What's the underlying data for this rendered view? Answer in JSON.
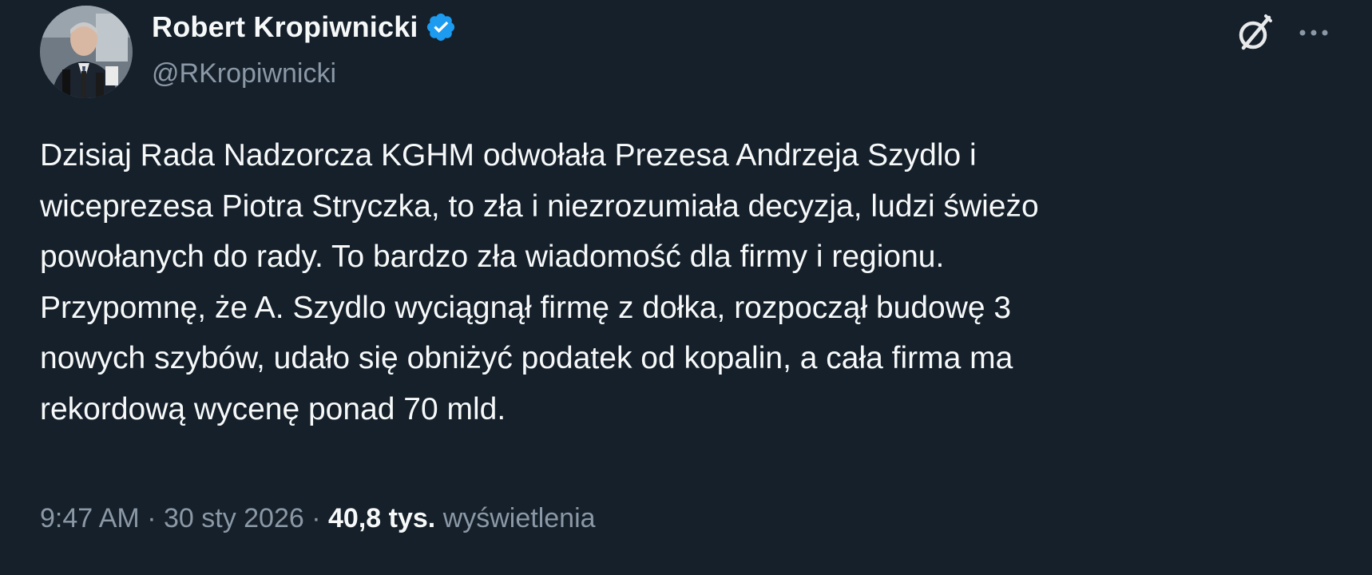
{
  "author": {
    "display_name": "Robert Kropiwnicki",
    "handle": "@RKropiwnicki",
    "verified": true
  },
  "icons": {
    "avatar": "profile-photo",
    "verified": "verified-badge-icon",
    "grok": "grok-icon",
    "more": "more-dots-icon"
  },
  "colors": {
    "background": "#15202b",
    "text_primary": "#f7f9f9",
    "text_secondary": "#8b98a5",
    "verified_blue": "#1d9bf0"
  },
  "tweet": {
    "text": "Dzisiaj Rada Nadzorcza KGHM odwołała Prezesa Andrzeja Szydlo i\nwiceprezesa Piotra Stryczka, to zła i niezrozumiała decyzja, ludzi świeżo\npowołanych do rady. To bardzo zła wiadomość dla firmy i regionu.\nPrzypomnę, że A. Szydlo wyciągnął firmę z dołka, rozpoczął budowę 3\nnowych szybów, udało się obniżyć podatek od kopalin, a cała firma ma\nrekordową wycenę ponad 70 mld."
  },
  "meta": {
    "time": "9:47 AM",
    "separator": "·",
    "date": "30 sty 2026",
    "views_count": "40,8 tys.",
    "views_label": "wyświetlenia"
  }
}
